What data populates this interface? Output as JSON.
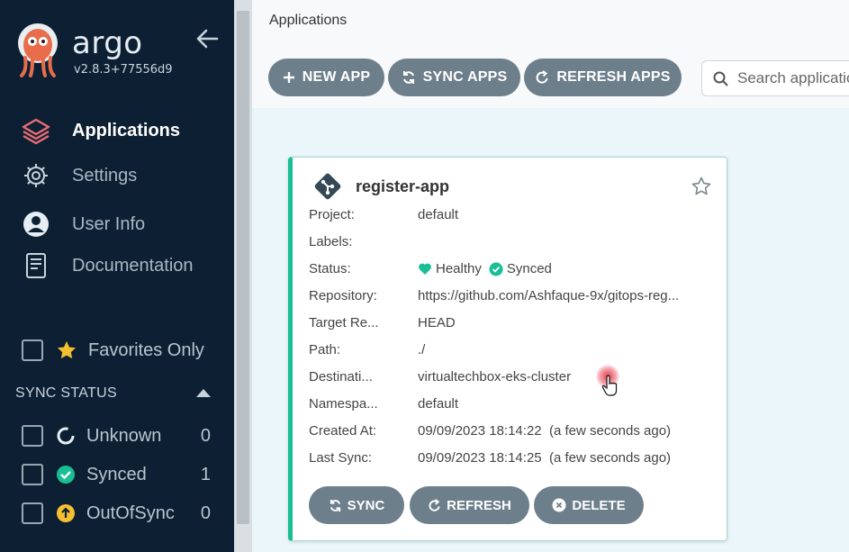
{
  "sidebar": {
    "brand": "argo",
    "version": "v2.8.3+77556d9",
    "nav": [
      {
        "label": "Applications",
        "icon": "layers-icon",
        "active": true
      },
      {
        "label": "Settings",
        "icon": "gear-icon"
      },
      {
        "label": "User Info",
        "icon": "user-icon"
      },
      {
        "label": "Documentation",
        "icon": "book-icon"
      }
    ],
    "favorites_label": "Favorites Only",
    "sync_status_heading": "SYNC STATUS",
    "sync_filters": [
      {
        "label": "Unknown",
        "count": "0"
      },
      {
        "label": "Synced",
        "count": "1"
      },
      {
        "label": "OutOfSync",
        "count": "0"
      }
    ]
  },
  "header": {
    "title": "Applications",
    "buttons": {
      "new_app": "NEW APP",
      "sync_apps": "SYNC APPS",
      "refresh_apps": "REFRESH APPS"
    },
    "search_placeholder": "Search applications..."
  },
  "app_card": {
    "name": "register-app",
    "fields": [
      {
        "key": "Project:",
        "value": "default"
      },
      {
        "key": "Labels:",
        "value": ""
      },
      {
        "key": "Status:",
        "health": "Healthy",
        "sync": "Synced"
      },
      {
        "key": "Repository:",
        "value": "https://github.com/Ashfaque-9x/gitops-reg..."
      },
      {
        "key": "Target Re...",
        "value": "HEAD"
      },
      {
        "key": "Path:",
        "value": "./"
      },
      {
        "key": "Destinati...",
        "value": "virtualtechbox-eks-cluster"
      },
      {
        "key": "Namespa...",
        "value": "default"
      },
      {
        "key": "Created At:",
        "value": "09/09/2023 18:14:22  (a few seconds ago)"
      },
      {
        "key": "Last Sync:",
        "value": "09/09/2023 18:14:25  (a few seconds ago)"
      }
    ],
    "buttons": {
      "sync": "SYNC",
      "refresh": "REFRESH",
      "delete": "DELETE"
    }
  },
  "colors": {
    "sidebar_bg": "#0d2033",
    "healthy": "#18be94",
    "out_of_sync": "#f4c030",
    "button_bg": "#6d7f8b",
    "accent_red": "#e96d76"
  }
}
